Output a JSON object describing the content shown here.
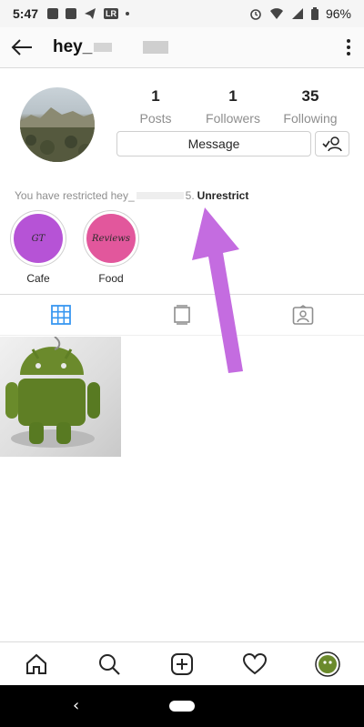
{
  "status_bar": {
    "time": "5:47",
    "left_badge": "LR",
    "battery": "96%"
  },
  "header": {
    "username": "hey_"
  },
  "profile": {
    "stats": [
      {
        "value": "1",
        "label": "Posts"
      },
      {
        "value": "1",
        "label": "Followers"
      },
      {
        "value": "35",
        "label": "Following"
      }
    ],
    "message_button": "Message",
    "restrict_notice": "You have restricted hey_",
    "restrict_suffix": "5.",
    "unrestrict_link": "Unrestrict"
  },
  "highlights": [
    {
      "label": "Cafe",
      "cover_text": "GT",
      "color": "#b653d6"
    },
    {
      "label": "Food",
      "cover_text": "Reviews",
      "color": "#e2579c"
    }
  ],
  "tabs": [
    "grid",
    "feed",
    "tagged"
  ],
  "colors": {
    "accent_blue": "#3897f0",
    "arrow": "#c46ce0"
  },
  "bottom_nav": [
    "home",
    "search",
    "add",
    "activity",
    "profile"
  ]
}
